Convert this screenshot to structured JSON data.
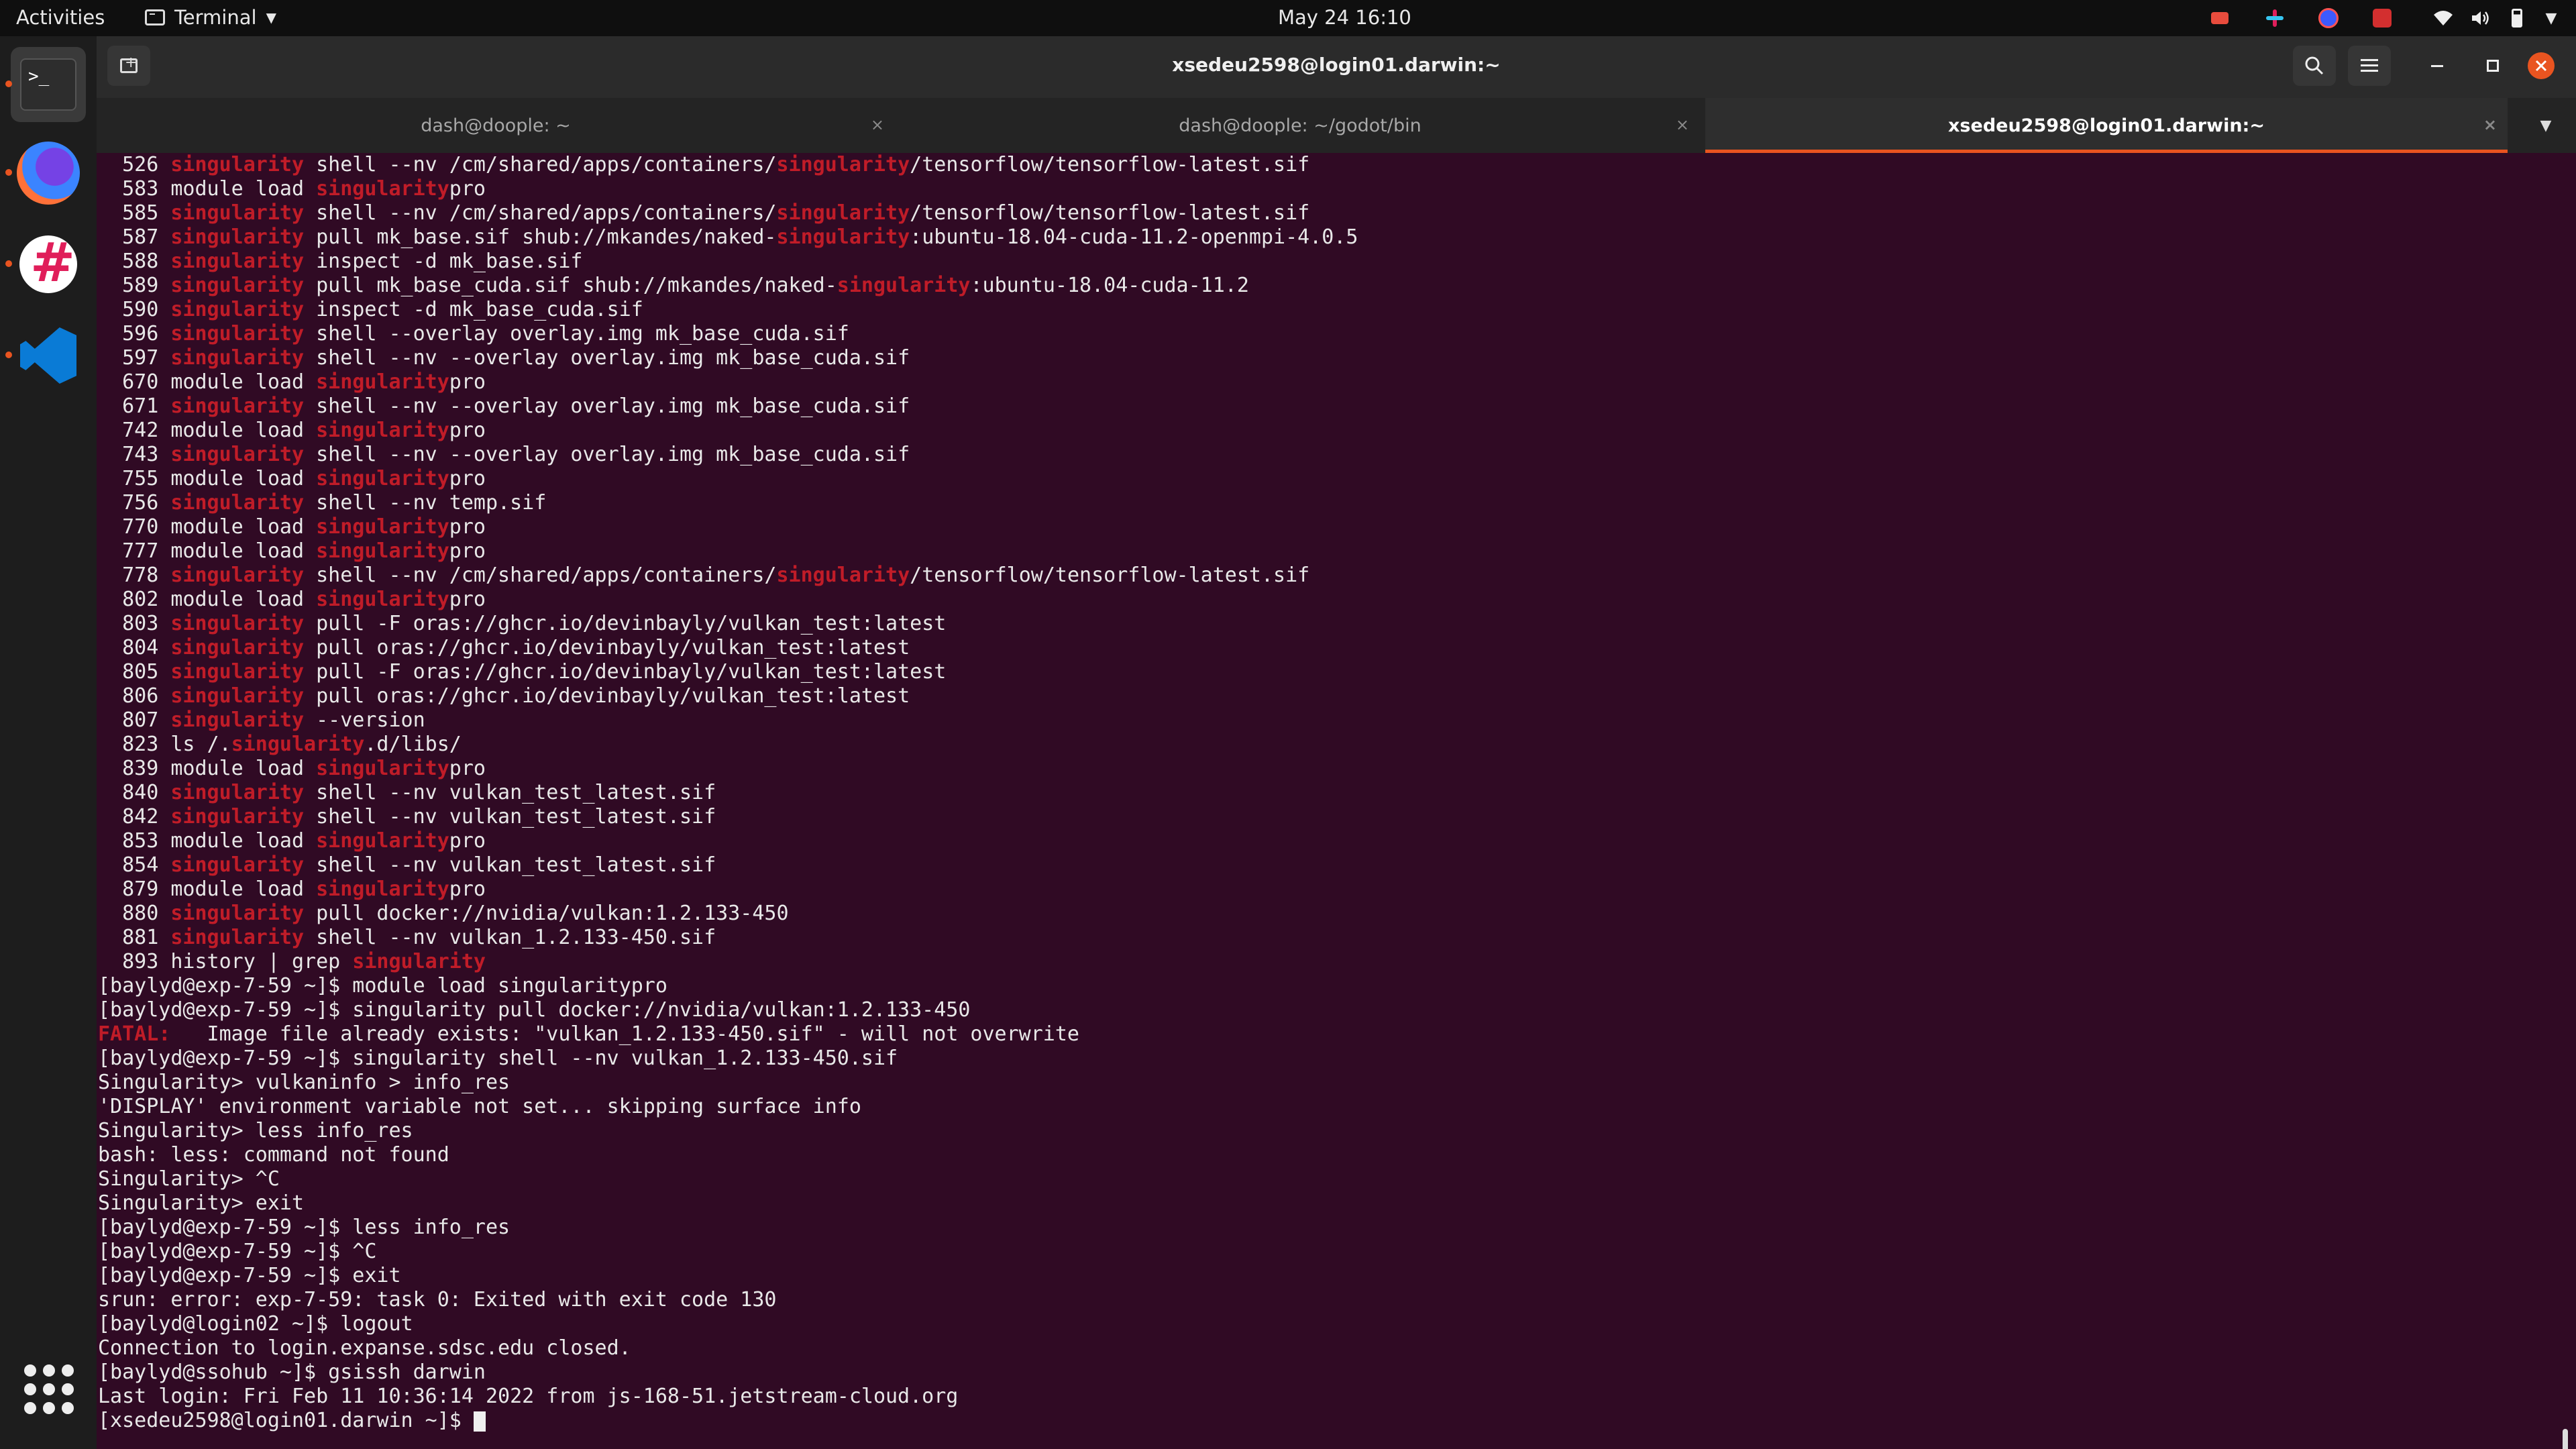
{
  "topbar": {
    "activities": "Activities",
    "app_name": "Terminal",
    "clock": "May 24  16:10"
  },
  "window": {
    "title": "xsedeu2598@login01.darwin:~"
  },
  "tabs": [
    {
      "label": "dash@doople: ~",
      "active": false
    },
    {
      "label": "dash@doople: ~/godot/bin",
      "active": false
    },
    {
      "label": "xsedeu2598@login01.darwin:~",
      "active": true
    }
  ],
  "icons": {
    "tab_close": "×",
    "dock_terminal": ">_"
  },
  "colors": {
    "accent": "#e95420",
    "terminal_bg": "#300a24",
    "highlight": "#c01c28"
  },
  "terminal": {
    "lines": [
      [
        {
          "t": "  526 "
        },
        {
          "t": "singularity",
          "hl": true
        },
        {
          "t": " shell --nv /cm/shared/apps/containers/"
        },
        {
          "t": "singularity",
          "hl": true
        },
        {
          "t": "/tensorflow/tensorflow-latest.sif"
        }
      ],
      [
        {
          "t": "  583 module load "
        },
        {
          "t": "singularity",
          "hl": true
        },
        {
          "t": "pro"
        }
      ],
      [
        {
          "t": "  585 "
        },
        {
          "t": "singularity",
          "hl": true
        },
        {
          "t": " shell --nv /cm/shared/apps/containers/"
        },
        {
          "t": "singularity",
          "hl": true
        },
        {
          "t": "/tensorflow/tensorflow-latest.sif"
        }
      ],
      [
        {
          "t": "  587 "
        },
        {
          "t": "singularity",
          "hl": true
        },
        {
          "t": " pull mk_base.sif shub://mkandes/naked-"
        },
        {
          "t": "singularity",
          "hl": true
        },
        {
          "t": ":ubuntu-18.04-cuda-11.2-openmpi-4.0.5"
        }
      ],
      [
        {
          "t": "  588 "
        },
        {
          "t": "singularity",
          "hl": true
        },
        {
          "t": " inspect -d mk_base.sif"
        }
      ],
      [
        {
          "t": "  589 "
        },
        {
          "t": "singularity",
          "hl": true
        },
        {
          "t": " pull mk_base_cuda.sif shub://mkandes/naked-"
        },
        {
          "t": "singularity",
          "hl": true
        },
        {
          "t": ":ubuntu-18.04-cuda-11.2"
        }
      ],
      [
        {
          "t": "  590 "
        },
        {
          "t": "singularity",
          "hl": true
        },
        {
          "t": " inspect -d mk_base_cuda.sif"
        }
      ],
      [
        {
          "t": "  596 "
        },
        {
          "t": "singularity",
          "hl": true
        },
        {
          "t": " shell --overlay overlay.img mk_base_cuda.sif"
        }
      ],
      [
        {
          "t": "  597 "
        },
        {
          "t": "singularity",
          "hl": true
        },
        {
          "t": " shell --nv --overlay overlay.img mk_base_cuda.sif"
        }
      ],
      [
        {
          "t": "  670 module load "
        },
        {
          "t": "singularity",
          "hl": true
        },
        {
          "t": "pro"
        }
      ],
      [
        {
          "t": "  671 "
        },
        {
          "t": "singularity",
          "hl": true
        },
        {
          "t": " shell --nv --overlay overlay.img mk_base_cuda.sif"
        }
      ],
      [
        {
          "t": "  742 module load "
        },
        {
          "t": "singularity",
          "hl": true
        },
        {
          "t": "pro"
        }
      ],
      [
        {
          "t": "  743 "
        },
        {
          "t": "singularity",
          "hl": true
        },
        {
          "t": " shell --nv --overlay overlay.img mk_base_cuda.sif"
        }
      ],
      [
        {
          "t": "  755 module load "
        },
        {
          "t": "singularity",
          "hl": true
        },
        {
          "t": "pro"
        }
      ],
      [
        {
          "t": "  756 "
        },
        {
          "t": "singularity",
          "hl": true
        },
        {
          "t": " shell --nv temp.sif"
        }
      ],
      [
        {
          "t": "  770 module load "
        },
        {
          "t": "singularity",
          "hl": true
        },
        {
          "t": "pro"
        }
      ],
      [
        {
          "t": "  777 module load "
        },
        {
          "t": "singularity",
          "hl": true
        },
        {
          "t": "pro"
        }
      ],
      [
        {
          "t": "  778 "
        },
        {
          "t": "singularity",
          "hl": true
        },
        {
          "t": " shell --nv /cm/shared/apps/containers/"
        },
        {
          "t": "singularity",
          "hl": true
        },
        {
          "t": "/tensorflow/tensorflow-latest.sif"
        }
      ],
      [
        {
          "t": "  802 module load "
        },
        {
          "t": "singularity",
          "hl": true
        },
        {
          "t": "pro"
        }
      ],
      [
        {
          "t": "  803 "
        },
        {
          "t": "singularity",
          "hl": true
        },
        {
          "t": " pull -F oras://ghcr.io/devinbayly/vulkan_test:latest"
        }
      ],
      [
        {
          "t": "  804 "
        },
        {
          "t": "singularity",
          "hl": true
        },
        {
          "t": " pull oras://ghcr.io/devinbayly/vulkan_test:latest"
        }
      ],
      [
        {
          "t": "  805 "
        },
        {
          "t": "singularity",
          "hl": true
        },
        {
          "t": " pull -F oras://ghcr.io/devinbayly/vulkan_test:latest"
        }
      ],
      [
        {
          "t": "  806 "
        },
        {
          "t": "singularity",
          "hl": true
        },
        {
          "t": " pull oras://ghcr.io/devinbayly/vulkan_test:latest"
        }
      ],
      [
        {
          "t": "  807 "
        },
        {
          "t": "singularity",
          "hl": true
        },
        {
          "t": " --version"
        }
      ],
      [
        {
          "t": "  823 ls /."
        },
        {
          "t": "singularity",
          "hl": true
        },
        {
          "t": ".d/libs/"
        }
      ],
      [
        {
          "t": "  839 module load "
        },
        {
          "t": "singularity",
          "hl": true
        },
        {
          "t": "pro"
        }
      ],
      [
        {
          "t": "  840 "
        },
        {
          "t": "singularity",
          "hl": true
        },
        {
          "t": " shell --nv vulkan_test_latest.sif"
        }
      ],
      [
        {
          "t": "  842 "
        },
        {
          "t": "singularity",
          "hl": true
        },
        {
          "t": " shell --nv vulkan_test_latest.sif"
        }
      ],
      [
        {
          "t": "  853 module load "
        },
        {
          "t": "singularity",
          "hl": true
        },
        {
          "t": "pro"
        }
      ],
      [
        {
          "t": "  854 "
        },
        {
          "t": "singularity",
          "hl": true
        },
        {
          "t": " shell --nv vulkan_test_latest.sif"
        }
      ],
      [
        {
          "t": "  879 module load "
        },
        {
          "t": "singularity",
          "hl": true
        },
        {
          "t": "pro"
        }
      ],
      [
        {
          "t": "  880 "
        },
        {
          "t": "singularity",
          "hl": true
        },
        {
          "t": " pull docker://nvidia/vulkan:1.2.133-450"
        }
      ],
      [
        {
          "t": "  881 "
        },
        {
          "t": "singularity",
          "hl": true
        },
        {
          "t": " shell --nv vulkan_1.2.133-450.sif"
        }
      ],
      [
        {
          "t": "  893 history | grep "
        },
        {
          "t": "singularity",
          "hl": true
        }
      ],
      [
        {
          "t": "[baylyd@exp-7-59 ~]$ module load singularitypro"
        }
      ],
      [
        {
          "t": "[baylyd@exp-7-59 ~]$ singularity pull docker://nvidia/vulkan:1.2.133-450"
        }
      ],
      [
        {
          "t": "FATAL: ",
          "hl": true
        },
        {
          "t": "  Image file already exists: \"vulkan_1.2.133-450.sif\" - will not overwrite"
        }
      ],
      [
        {
          "t": "[baylyd@exp-7-59 ~]$ singularity shell --nv vulkan_1.2.133-450.sif"
        }
      ],
      [
        {
          "t": "Singularity> vulkaninfo > info_res"
        }
      ],
      [
        {
          "t": "'DISPLAY' environment variable not set... skipping surface info"
        }
      ],
      [
        {
          "t": "Singularity> less info_res"
        }
      ],
      [
        {
          "t": "bash: less: command not found"
        }
      ],
      [
        {
          "t": "Singularity> ^C"
        }
      ],
      [
        {
          "t": "Singularity> exit"
        }
      ],
      [
        {
          "t": "[baylyd@exp-7-59 ~]$ less info_res"
        }
      ],
      [
        {
          "t": "[baylyd@exp-7-59 ~]$ ^C"
        }
      ],
      [
        {
          "t": "[baylyd@exp-7-59 ~]$ exit"
        }
      ],
      [
        {
          "t": "srun: error: exp-7-59: task 0: Exited with exit code 130"
        }
      ],
      [
        {
          "t": "[baylyd@login02 ~]$ logout"
        }
      ],
      [
        {
          "t": "Connection to login.expanse.sdsc.edu closed."
        }
      ],
      [
        {
          "t": "[baylyd@ssohub ~]$ gsissh darwin"
        }
      ],
      [
        {
          "t": "Last login: Fri Feb 11 10:36:14 2022 from js-168-51.jetstream-cloud.org"
        }
      ],
      [
        {
          "t": "[xsedeu2598@login01.darwin ~]$ "
        }
      ]
    ]
  }
}
